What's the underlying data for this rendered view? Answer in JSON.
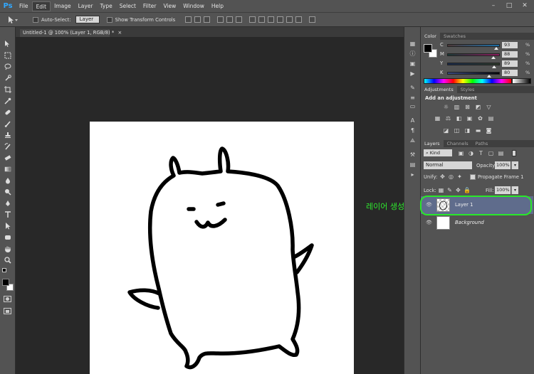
{
  "app": {
    "logo": "Ps"
  },
  "menu": [
    "File",
    "Edit",
    "Image",
    "Layer",
    "Type",
    "Select",
    "Filter",
    "View",
    "Window",
    "Help"
  ],
  "window_controls": {
    "minimize": "–",
    "maximize": "□",
    "close": "✕"
  },
  "options_bar": {
    "auto_select_label": "Auto-Select:",
    "auto_select_value": "Layer",
    "transform_label": "Show Transform Controls"
  },
  "document": {
    "tab_title": "Untitled-1 @ 100% (Layer 1, RGB/8) *",
    "close": "×"
  },
  "tools": [
    "move-tool",
    "marquee-tool",
    "lasso-tool",
    "quick-select-tool",
    "crop-tool",
    "eyedropper-tool",
    "healing-tool",
    "brush-tool",
    "stamp-tool",
    "history-brush-tool",
    "eraser-tool",
    "gradient-tool",
    "blur-tool",
    "dodge-tool",
    "pen-tool",
    "type-tool",
    "path-select-tool",
    "shape-tool",
    "hand-tool",
    "zoom-tool"
  ],
  "color_panel": {
    "tabs": [
      "Color",
      "Swatches"
    ],
    "channels": [
      {
        "label": "C",
        "value": "93",
        "unit": "%",
        "level": 0.93
      },
      {
        "label": "M",
        "value": "88",
        "unit": "%",
        "level": 0.88
      },
      {
        "label": "Y",
        "value": "89",
        "unit": "%",
        "level": 0.89
      },
      {
        "label": "K",
        "value": "80",
        "unit": "%",
        "level": 0.8
      }
    ]
  },
  "adjustments_panel": {
    "tabs": [
      "Adjustments",
      "Styles"
    ],
    "title": "Add an adjustment"
  },
  "layers_panel": {
    "tabs": [
      "Layers",
      "Channels",
      "Paths"
    ],
    "filter_kind": "Kind",
    "blend_mode": "Normal",
    "opacity_label": "Opacity:",
    "opacity_value": "100%",
    "unify_label": "Unify:",
    "propagate_label": "Propagate Frame 1",
    "lock_label": "Lock:",
    "fill_label": "Fill:",
    "fill_value": "100%",
    "layers": [
      {
        "name": "Layer 1",
        "selected": true
      },
      {
        "name": "Background",
        "selected": false
      }
    ]
  },
  "annotation": {
    "text": "레이어 생성",
    "color": "#2ee82e"
  },
  "colors": {
    "accent": "#31a8ff",
    "selected_layer": "#5f6c8c",
    "annotation": "#29e829"
  }
}
